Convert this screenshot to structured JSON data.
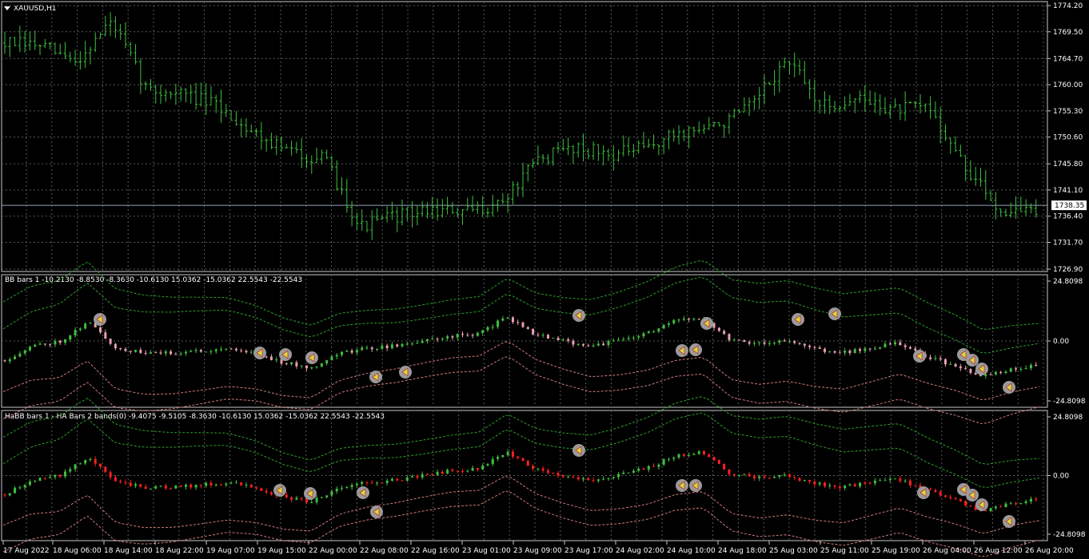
{
  "window": {
    "symbol_title": "XAUUSD,H1",
    "current_price": "1738.35"
  },
  "colors": {
    "background": "#000000",
    "grid": "#5a5a5a",
    "bull": "#3fbf3f",
    "bear_bb": "#e8a0b0",
    "bear_ha": "#ff2020",
    "upper_band": "#2e9e2e",
    "lower_band": "#d07a7a",
    "price_line": "#8fa3b8",
    "marker": "#9a9a9a"
  },
  "icons": [
    "collapse-triangle-icon",
    "arrow-left-marker-icon"
  ],
  "chart_data": [
    {
      "type": "bar",
      "name": "price-panel",
      "title": "XAUUSD,H1",
      "ylim": [
        1726.9,
        1774.2
      ],
      "yticks": [
        "1774.20",
        "1769.50",
        "1764.70",
        "1760.00",
        "1755.30",
        "1750.60",
        "1745.80",
        "1741.10",
        "1736.40",
        "1731.70",
        "1726.90"
      ],
      "current_price": 1738.35,
      "grid": true,
      "x_tick_labels": [
        "17 Aug 2022",
        "18 Aug 06:00",
        "18 Aug 14:00",
        "18 Aug 22:00",
        "19 Aug 07:00",
        "19 Aug 15:00",
        "22 Aug 00:00",
        "22 Aug 08:00",
        "22 Aug 16:00",
        "23 Aug 01:00",
        "23 Aug 09:00",
        "23 Aug 17:00",
        "24 Aug 02:00",
        "24 Aug 10:00",
        "24 Aug 18:00",
        "25 Aug 03:00",
        "25 Aug 11:00",
        "25 Aug 19:00",
        "26 Aug 04:00",
        "26 Aug 12:00",
        "26 Aug 20:00"
      ],
      "close_anchors": [
        1767.5,
        1767,
        1764,
        1771.5,
        1759,
        1758.5,
        1756,
        1751.5,
        1748,
        1746.5,
        1734.5,
        1736.5,
        1737.5,
        1737,
        1739,
        1746.5,
        1749,
        1747.5,
        1748.5,
        1751.5,
        1752.5,
        1756,
        1764.5,
        1756,
        1757.5,
        1755.5,
        1756,
        1745,
        1737.5,
        1737.5
      ]
    },
    {
      "type": "bar",
      "name": "bb-panel",
      "title": "BB bars 1 -10.2130 -8.8530 -8.3630 -10.6130 15.0362 -15.0362 22.5543 -22.5543",
      "ylim": [
        -24.8098,
        24.8098
      ],
      "yticks": [
        "24.8098",
        "0.00",
        "-24.8098"
      ],
      "grid": true,
      "center_anchors": [
        -8,
        -2,
        0,
        8,
        -3,
        -5,
        -5,
        -4,
        -3,
        -5,
        -9,
        -11,
        -5,
        -3,
        -2,
        0,
        2,
        3,
        10,
        3,
        0,
        -2,
        0,
        3,
        8,
        10,
        1,
        -1,
        0,
        -3,
        -5,
        -3,
        -1,
        -6,
        -10,
        -15,
        -12,
        -10
      ]
    },
    {
      "type": "bar",
      "name": "habb-panel",
      "title": "HaBB bars 1 - HA Bars 2 bands(0) -9.4075 -9.5105 -8.3630 -10.6130 15.0362 -15.0362 22.5543 -22.5543",
      "ylim": [
        -24.8098,
        24.8098
      ],
      "yticks": [
        "24.8098",
        "0.00",
        "-24.8098"
      ],
      "grid": true,
      "center_anchors": [
        -8,
        -2,
        0,
        8,
        -3,
        -5,
        -5,
        -4,
        -3,
        -5,
        -9,
        -11,
        -5,
        -3,
        -2,
        0,
        2,
        3,
        10,
        3,
        0,
        -2,
        0,
        3,
        8,
        10,
        1,
        -1,
        0,
        -3,
        -5,
        -3,
        -1,
        -6,
        -10,
        -15,
        -12,
        -10
      ]
    }
  ]
}
